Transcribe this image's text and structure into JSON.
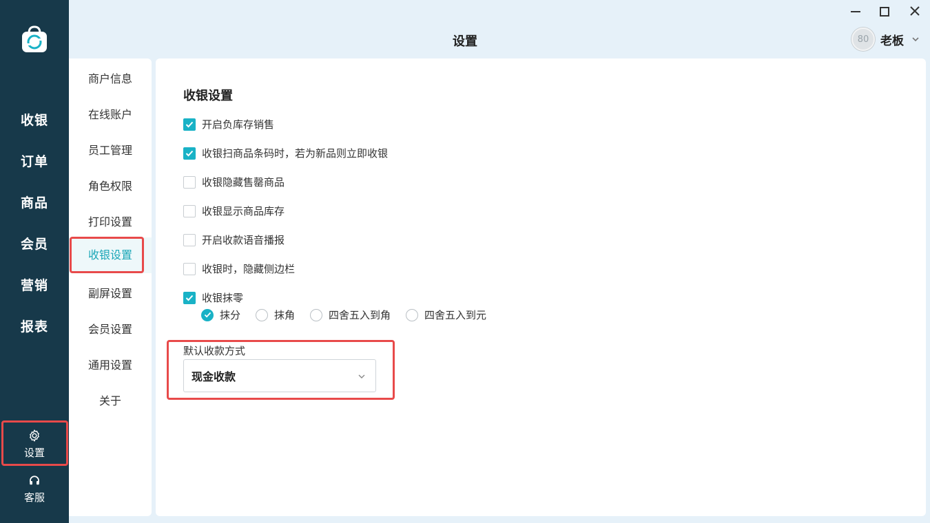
{
  "window": {
    "title": "设置",
    "controls": [
      "minimize-icon",
      "maximize-icon",
      "close-icon"
    ]
  },
  "user": {
    "avatar_text": "80",
    "name": "老板"
  },
  "sidebar": {
    "items": [
      {
        "label": "收银"
      },
      {
        "label": "订单"
      },
      {
        "label": "商品"
      },
      {
        "label": "会员"
      },
      {
        "label": "营销"
      },
      {
        "label": "报表"
      }
    ],
    "settings_label": "设置",
    "service_label": "客服"
  },
  "submenu": {
    "items": [
      {
        "label": "商户信息"
      },
      {
        "label": "在线账户"
      },
      {
        "label": "员工管理"
      },
      {
        "label": "角色权限"
      },
      {
        "label": "打印设置"
      },
      {
        "label": "收银设置"
      },
      {
        "label": "副屏设置"
      },
      {
        "label": "会员设置"
      },
      {
        "label": "通用设置"
      },
      {
        "label": "关于"
      }
    ],
    "active": "收银设置"
  },
  "cashier_settings": {
    "title": "收银设置",
    "options": [
      {
        "label": "开启负库存销售",
        "checked": true
      },
      {
        "label": "收银扫商品条码时，若为新品则立即收银",
        "checked": true
      },
      {
        "label": "收银隐藏售罄商品",
        "checked": false
      },
      {
        "label": "收银显示商品库存",
        "checked": false
      },
      {
        "label": "开启收款语音播报",
        "checked": false
      },
      {
        "label": "收银时，隐藏侧边栏",
        "checked": false
      },
      {
        "label": "收银抹零",
        "checked": true
      }
    ],
    "rounding": {
      "options": [
        {
          "label": "抹分",
          "selected": true
        },
        {
          "label": "抹角",
          "selected": false
        },
        {
          "label": "四舍五入到角",
          "selected": false
        },
        {
          "label": "四舍五入到元",
          "selected": false
        }
      ]
    },
    "default_payment": {
      "label": "默认收款方式",
      "value": "现金收款"
    }
  },
  "colors": {
    "sidebar_bg": "#17394a",
    "accent": "#19b2c6",
    "highlight_border": "#e84a4a",
    "page_bg": "#e6f1f9"
  }
}
